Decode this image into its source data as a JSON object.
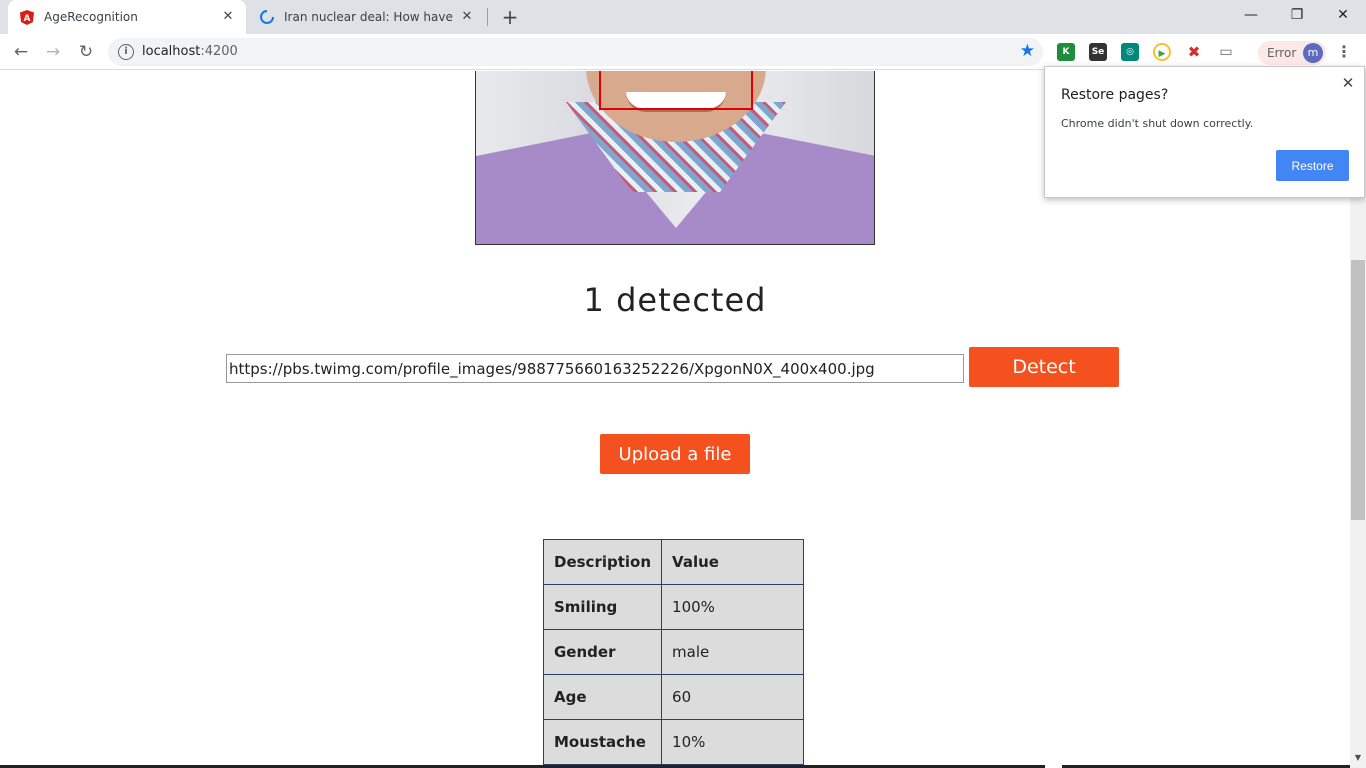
{
  "browser": {
    "tabs": [
      {
        "title": "AgeRecognition",
        "active": true,
        "icon": "angular-icon"
      },
      {
        "title": "Iran nuclear deal: How have US s...",
        "active": false,
        "icon": "loading-spinner-icon"
      }
    ],
    "address": {
      "host": "localhost",
      "port": ":4200"
    },
    "error_label": "Error",
    "avatar_initial": "m"
  },
  "page": {
    "detected_text": "1 detected",
    "url_input_value": "https://pbs.twimg.com/profile_images/988775660163252226/XpgonN0X_400x400.jpg",
    "detect_label": "Detect",
    "upload_label": "Upload a file",
    "table": {
      "headers": [
        "Description",
        "Value"
      ],
      "rows": [
        {
          "description": "Smiling",
          "value": "100%"
        },
        {
          "description": "Gender",
          "value": "male"
        },
        {
          "description": "Age",
          "value": "60"
        },
        {
          "description": "Moustache",
          "value": "10%"
        }
      ]
    }
  },
  "popup": {
    "title": "Restore pages?",
    "message": "Chrome didn't shut down correctly.",
    "button_label": "Restore"
  },
  "colors": {
    "accent_button": "#f4511e",
    "restore_button": "#4285f4",
    "face_box": "#e00000"
  }
}
